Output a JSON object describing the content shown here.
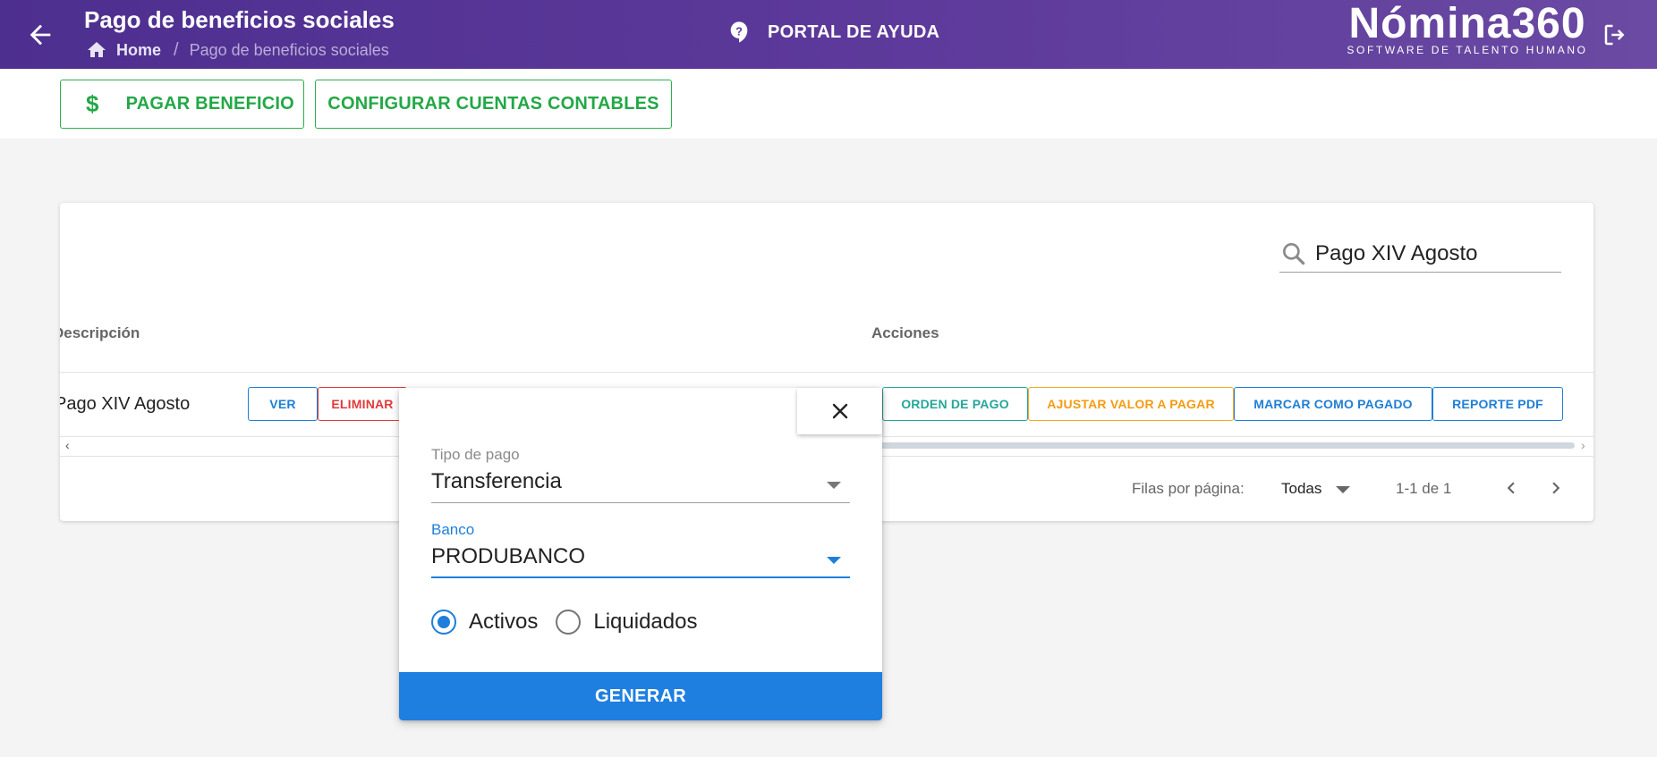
{
  "header": {
    "title": "Pago de beneficios sociales",
    "breadcrumb_home": "Home",
    "breadcrumb_sep": "/",
    "breadcrumb_current": "Pago de beneficios sociales",
    "help_label": "PORTAL DE AYUDA",
    "logo_main": "Nómina360",
    "logo_sub": "SOFTWARE DE TALENTO HUMANO",
    "bg_color": "#5a3a9a"
  },
  "toolbar": {
    "pagar_icon": "$",
    "pagar_label": "PAGAR BENEFICIO",
    "config_label": "CONFIGURAR CUENTAS CONTABLES",
    "accent_color": "#22a846"
  },
  "table": {
    "search_value": "Pago XIV Agosto",
    "columns": [
      "Descripción",
      "Acciones"
    ],
    "rows": [
      {
        "descripcion": "Pago XIV Agosto",
        "actions": [
          "VER",
          "ELIMINAR",
          "ORDEN DE PAGO",
          "AJUSTAR VALOR A PAGAR",
          "MARCAR COMO PAGADO",
          "REPORTE PDF"
        ]
      }
    ],
    "scroll_left": "‹",
    "scroll_right": "›",
    "rows_per_page_label": "Filas por página:",
    "rows_per_page_value": "Todas",
    "range": "1-1 de 1"
  },
  "popup": {
    "tipo_label": "Tipo de pago",
    "tipo_value": "Transferencia",
    "banco_label": "Banco",
    "banco_value": "PRODUBANCO",
    "radio_options": [
      "Activos",
      "Liquidados"
    ],
    "radio_selected": "Activos",
    "generate_label": "GENERAR",
    "primary_color": "#1e7fe0"
  }
}
